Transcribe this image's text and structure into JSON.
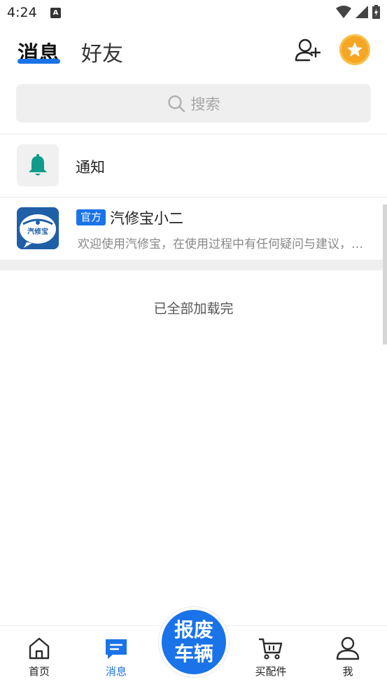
{
  "status_bar": {
    "time": "4:24",
    "indicator": "A"
  },
  "header": {
    "tabs": [
      {
        "label": "消息",
        "active": true
      },
      {
        "label": "好友",
        "active": false
      }
    ],
    "add_friend_icon": "add-user-icon",
    "vip_icon": "star-badge-icon"
  },
  "search": {
    "placeholder": "搜索"
  },
  "notification": {
    "label": "通知",
    "icon": "bell-icon",
    "icon_color": "#119b8a"
  },
  "chat": {
    "tag": "官方",
    "name": "汽修宝小二",
    "preview": "欢迎使用汽修宝，在使用过程中有任何疑问与建议，请随时联系我们",
    "avatar_text": "汽修宝"
  },
  "list_end": "已全部加载完",
  "bottom_nav": {
    "home": "首页",
    "messages": "消息",
    "scrap_line1": "报废",
    "scrap_line2": "车辆",
    "parts": "买配件",
    "me": "我"
  },
  "colors": {
    "accent": "#1a73e8",
    "badge": "#f5a623"
  }
}
